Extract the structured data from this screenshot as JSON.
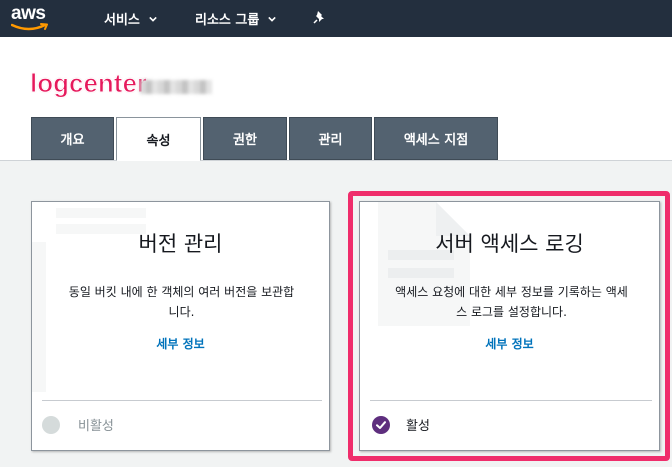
{
  "nav": {
    "logo_text": "aws",
    "services_label": "서비스",
    "resource_groups_label": "리소스 그룹"
  },
  "header": {
    "bucket_name": "logcenter"
  },
  "tabs": [
    {
      "label": "개요",
      "active": false
    },
    {
      "label": "속성",
      "active": true
    },
    {
      "label": "권한",
      "active": false
    },
    {
      "label": "관리",
      "active": false
    },
    {
      "label": "액세스 지점",
      "active": false
    }
  ],
  "cards": {
    "versioning": {
      "title": "버전 관리",
      "description_line1": "동일 버킷 내에 한 객체의 여러 버전을 보관합",
      "description_line2": "니다.",
      "link": "세부 정보",
      "status": "비활성",
      "status_color": "#d5dbdb"
    },
    "server_access_logging": {
      "title": "서버 액세스 로깅",
      "description_line1": "액세스 요청에 대한 세부 정보를 기록하는 액세",
      "description_line2": "스 로그를 설정합니다.",
      "link": "세부 정보",
      "status": "활성",
      "status_color": "#5e2e7e"
    }
  },
  "colors": {
    "nav_bg": "#232f3e",
    "tab_bg": "#536270",
    "link": "#0073bb",
    "highlight": "#ef2d6b",
    "bucket_title": "#e6195c"
  }
}
